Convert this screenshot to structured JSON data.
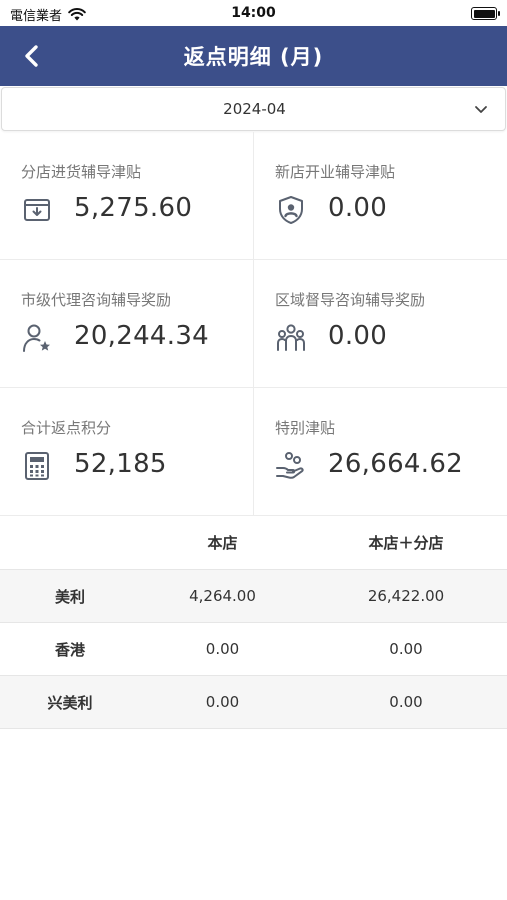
{
  "status": {
    "carrier": "電信業者",
    "time": "14:00"
  },
  "nav": {
    "title": "返点明细 (月)"
  },
  "month_select": {
    "value": "2024-04"
  },
  "cards": [
    {
      "label": "分店进货辅导津贴",
      "value": "5,275.60",
      "icon": "inbox-download-icon"
    },
    {
      "label": "新店开业辅导津贴",
      "value": "0.00",
      "icon": "shield-user-icon"
    },
    {
      "label": "市级代理咨询辅导奖励",
      "value": "20,244.34",
      "icon": "user-star-icon"
    },
    {
      "label": "区域督导咨询辅导奖励",
      "value": "0.00",
      "icon": "group-icon"
    },
    {
      "label": "合计返点积分",
      "value": "52,185",
      "icon": "calculator-icon"
    },
    {
      "label": "特别津贴",
      "value": "26,664.62",
      "icon": "hand-coins-icon"
    }
  ],
  "table": {
    "headers": [
      "",
      "本店",
      "本店＋分店"
    ],
    "rows": [
      [
        "美利",
        "4,264.00",
        "26,422.00"
      ],
      [
        "香港",
        "0.00",
        "0.00"
      ],
      [
        "兴美利",
        "0.00",
        "0.00"
      ]
    ]
  },
  "colors": {
    "nav_bg": "#3c4f8a",
    "icon": "#5a6270"
  }
}
